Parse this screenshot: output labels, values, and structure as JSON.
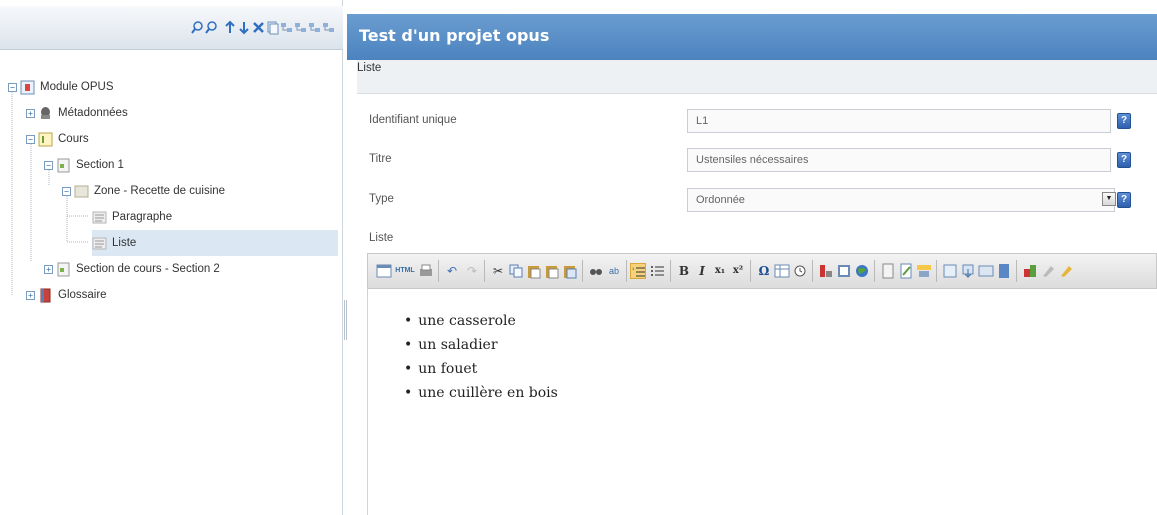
{
  "tree": {
    "nodes": [
      {
        "label": "Module OPUS"
      },
      {
        "label": "Métadonnées"
      },
      {
        "label": "Cours"
      },
      {
        "label": "Section 1"
      },
      {
        "label": "Zone - Recette de cuisine"
      },
      {
        "label": "Paragraphe"
      },
      {
        "label": "Liste"
      },
      {
        "label": "Section de cours - Section 2"
      },
      {
        "label": "Glossaire"
      }
    ],
    "selected": "Liste"
  },
  "header": {
    "title": "Test d'un projet opus"
  },
  "section": {
    "title": "Liste"
  },
  "form": {
    "id_label": "Identifiant unique",
    "id_value": "L1",
    "title_label": "Titre",
    "title_value": "Ustensiles nécessaires",
    "type_label": "Type",
    "type_value": "Ordonnée",
    "help_glyph": "?"
  },
  "editor": {
    "label": "Liste",
    "toolbar": {
      "bold": "B",
      "italic": "I",
      "subscript": "x₁",
      "superscript": "x²",
      "omega": "Ω",
      "html": "HTML"
    },
    "items": [
      "une casserole",
      "un saladier",
      "un fouet",
      "une cuillère en bois"
    ]
  },
  "colors": {
    "title_bar": "#5a8fc8",
    "selected_row": "#dbe8f4",
    "help_button": "#3b6cc0"
  }
}
